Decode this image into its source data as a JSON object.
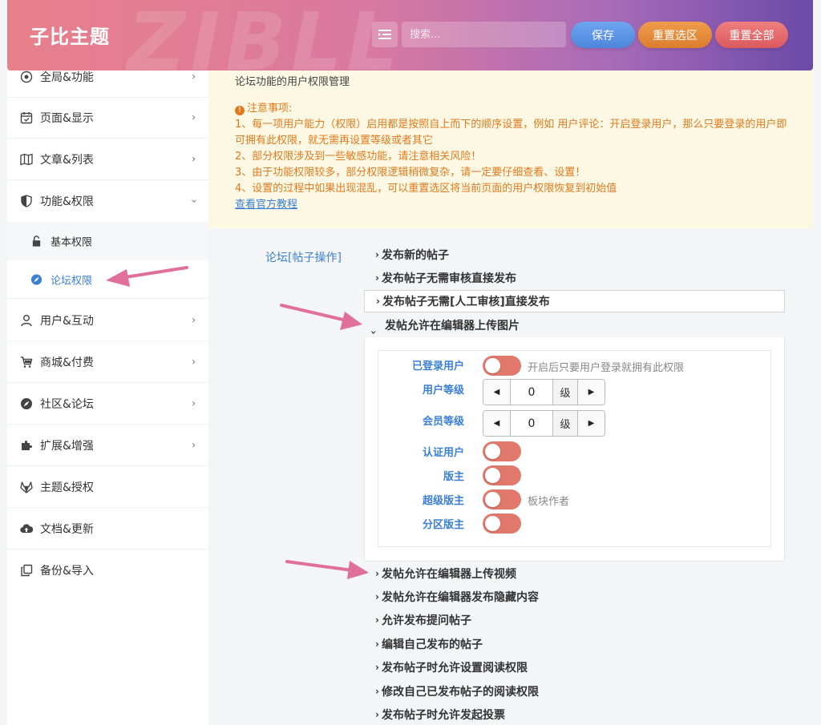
{
  "header": {
    "brand": "子比主题",
    "watermark": "ZIBLL",
    "search_placeholder": "搜索...",
    "save_label": "保存",
    "reset_section_label": "重置选区",
    "reset_all_label": "重置全部"
  },
  "sidebar": {
    "items": [
      {
        "label": "全局&功能",
        "icon": "target-icon"
      },
      {
        "label": "页面&显示",
        "icon": "calendar-icon"
      },
      {
        "label": "文章&列表",
        "icon": "map-icon"
      },
      {
        "label": "功能&权限",
        "icon": "shield-icon"
      },
      {
        "label": "用户&互动",
        "icon": "user-icon"
      },
      {
        "label": "商城&付费",
        "icon": "cart-icon"
      },
      {
        "label": "社区&论坛",
        "icon": "compass-icon"
      },
      {
        "label": "扩展&增强",
        "icon": "puzzle-icon"
      },
      {
        "label": "主题&授权",
        "icon": "gitlab-icon"
      },
      {
        "label": "文档&更新",
        "icon": "cloud-upload-icon"
      },
      {
        "label": "备份&导入",
        "icon": "copy-icon"
      }
    ],
    "sub_items": [
      {
        "label": "基本权限",
        "icon": "lock-icon"
      },
      {
        "label": "论坛权限",
        "icon": "compass-icon"
      }
    ]
  },
  "notice": {
    "title": "论坛功能的用户权限管理",
    "heading": "注意事项:",
    "line1": "1、每一项用户能力（权限）启用都是按照自上而下的顺序设置，例如 用户评论：开启登录用户，那么只要登录的用户即可拥有此权限，就无需再设置等级或者其它",
    "line2": "2、部分权限涉及到一些敏感功能，请注意相关风险！",
    "line3": "3、由于功能权限较多，部分权限逻辑稍微复杂，请一定要仔细查看、设置！",
    "line4": "4、设置的过程中如果出现混乱，可以重置选区将当前页面的用户权限恢复到初始值",
    "link": "查看官方教程"
  },
  "section": {
    "label": "论坛[帖子操作]",
    "rows_top": [
      "发布新的帖子",
      "发布帖子无需审核直接发布",
      "发布帖子无需[人工审核]直接发布",
      "发帖允许在编辑器上传图片"
    ],
    "rows_bottom": [
      "发帖允许在编辑器上传视频",
      "发帖允许在编辑器发布隐藏内容",
      "允许发布提问帖子",
      "编辑自己发布的帖子",
      "发布帖子时允许设置阅读权限",
      "修改自己已发布帖子的阅读权限",
      "发布帖子时允许发起投票"
    ]
  },
  "fields": {
    "logged_in_label": "已登录用户",
    "logged_in_hint": "开启后只要用户登录就拥有此权限",
    "user_level_label": "用户等级",
    "user_level_value": "0",
    "member_level_label": "会员等级",
    "member_level_value": "0",
    "level_unit": "级",
    "verified_label": "认证用户",
    "moderator_label": "版主",
    "super_moderator_label": "超级版主",
    "super_moderator_hint": "板块作者",
    "zone_moderator_label": "分区版主"
  },
  "colors": {
    "accent": "#3a7fd5",
    "warning": "#e17a1f",
    "toggle": "#e0796c",
    "arrow": "#e0709a"
  }
}
